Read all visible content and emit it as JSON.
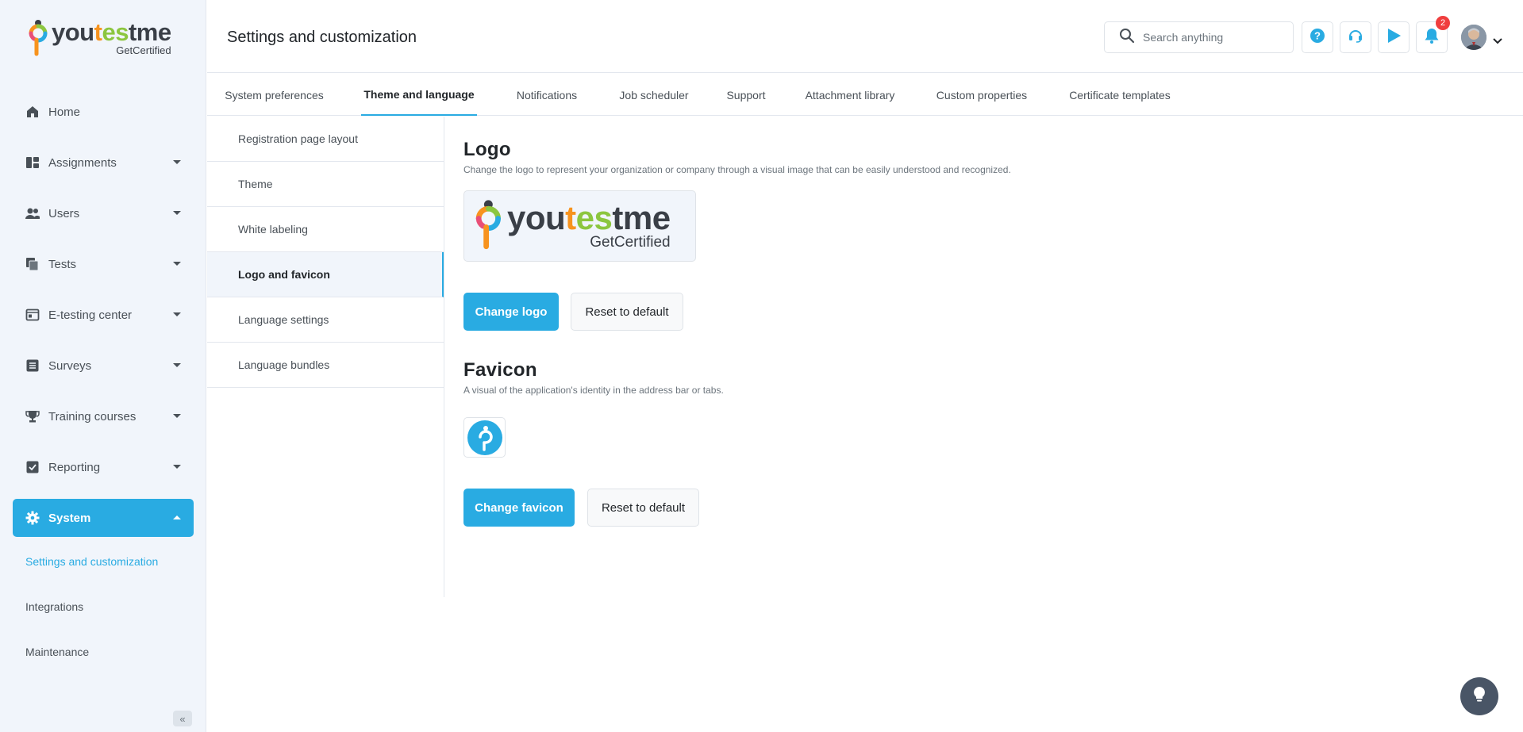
{
  "brand": {
    "name_parts": [
      "you",
      "t",
      "es",
      "tme"
    ],
    "subtitle": "GetCertified"
  },
  "sidebar": {
    "items": [
      {
        "label": "Home",
        "icon": "home-icon",
        "expandable": false
      },
      {
        "label": "Assignments",
        "icon": "assignments-icon",
        "expandable": true
      },
      {
        "label": "Users",
        "icon": "users-icon",
        "expandable": true
      },
      {
        "label": "Tests",
        "icon": "tests-icon",
        "expandable": true
      },
      {
        "label": "E-testing center",
        "icon": "e-testing-icon",
        "expandable": true
      },
      {
        "label": "Surveys",
        "icon": "surveys-icon",
        "expandable": true
      },
      {
        "label": "Training courses",
        "icon": "trophy-icon",
        "expandable": true
      },
      {
        "label": "Reporting",
        "icon": "reporting-icon",
        "expandable": true
      },
      {
        "label": "System",
        "icon": "gear-icon",
        "expandable": true,
        "active": true
      }
    ],
    "sub_items": [
      {
        "label": "Settings and customization",
        "active": true
      },
      {
        "label": "Integrations"
      },
      {
        "label": "Maintenance"
      }
    ],
    "collapse_icon": "double-chevron-left-icon"
  },
  "header": {
    "title": "Settings and customization",
    "search_placeholder": "Search anything",
    "notification_count": "2"
  },
  "tabs": [
    {
      "label": "System preferences"
    },
    {
      "label": "Theme and language",
      "active": true
    },
    {
      "label": "Notifications"
    },
    {
      "label": "Job scheduler"
    },
    {
      "label": "Support"
    },
    {
      "label": "Attachment library"
    },
    {
      "label": "Custom properties"
    },
    {
      "label": "Certificate templates"
    }
  ],
  "sublist": [
    {
      "label": "Registration page layout"
    },
    {
      "label": "Theme"
    },
    {
      "label": "White labeling"
    },
    {
      "label": "Logo and favicon",
      "active": true
    },
    {
      "label": "Language settings"
    },
    {
      "label": "Language bundles"
    }
  ],
  "logo_section": {
    "title": "Logo",
    "description": "Change the logo to represent your organization or company through a visual image that can be easily understood and recognized.",
    "change_label": "Change logo",
    "reset_label": "Reset to default"
  },
  "favicon_section": {
    "title": "Favicon",
    "description": "A visual of the application's identity in the address bar or tabs.",
    "change_label": "Change favicon",
    "reset_label": "Reset to default"
  },
  "colors": {
    "accent": "#29abe2",
    "sidebar_bg": "#f1f5fb",
    "badge": "#f03e3e"
  }
}
